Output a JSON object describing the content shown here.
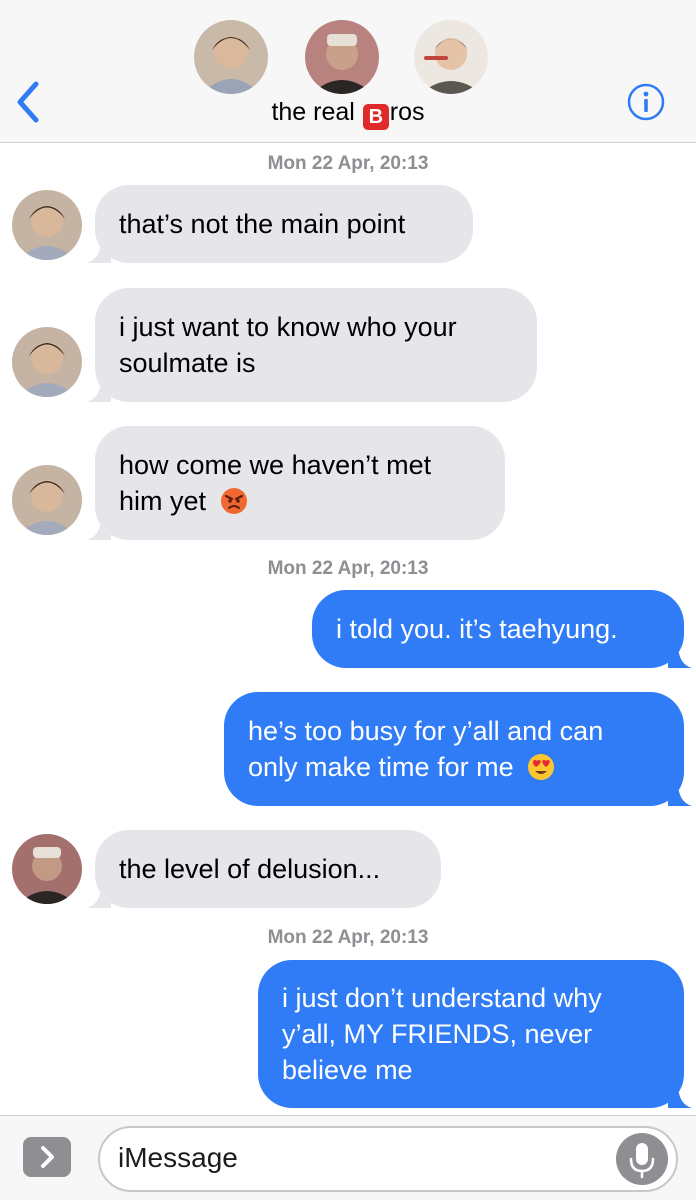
{
  "header": {
    "title_before": "the real ",
    "title_emoji": "B",
    "title_after": "ros",
    "back_icon": "chevron-left-icon",
    "info_icon": "info-icon"
  },
  "timestamps": [
    "Mon 22 Apr, 20:13",
    "Mon 22 Apr, 20:13",
    "Mon 22 Apr, 20:13"
  ],
  "messages": [
    {
      "text": "that’s not the main point"
    },
    {
      "text": "i just want to know who your soulmate is"
    },
    {
      "text": "how come we haven’t met him yet"
    },
    {
      "text": "i told you. it’s taehyung."
    },
    {
      "text": "he’s too busy for y’all and can only make time for me"
    },
    {
      "text": "the level of delusion..."
    },
    {
      "text": "i just don’t understand why y’all, MY FRIENDS, never believe me"
    }
  ],
  "composer": {
    "placeholder": "iMessage",
    "expand_icon": "chevron-right-icon",
    "mic_icon": "microphone-icon"
  },
  "colors": {
    "incoming_bubble": "#e5e5ea",
    "outgoing_bubble": "#2f7cf6",
    "accent": "#2f7cf6",
    "timestamp": "#8e8e93"
  }
}
